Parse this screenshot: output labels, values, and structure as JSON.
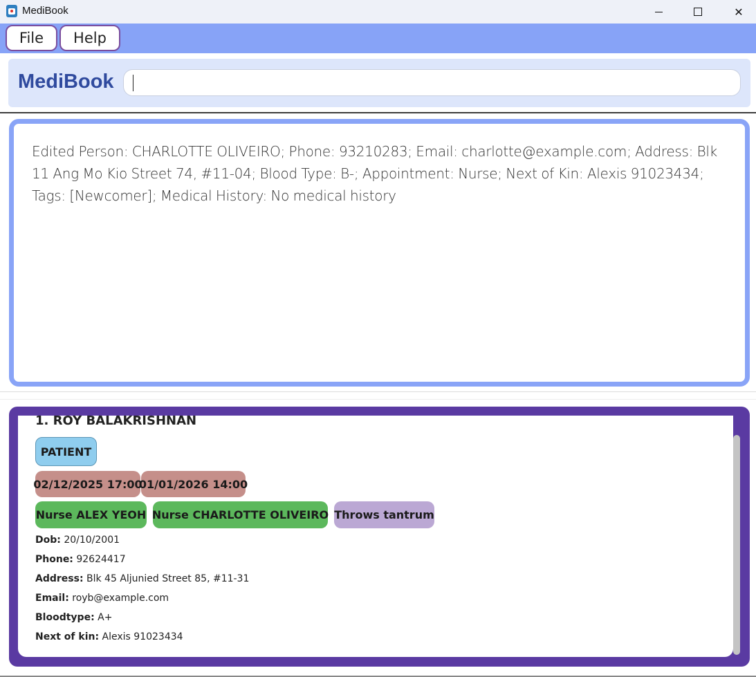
{
  "window": {
    "title": "MediBook",
    "min_icon": "minimize-icon",
    "max_icon": "maximize-icon",
    "close_glyph": "✕"
  },
  "menu": {
    "file": "File",
    "help": "Help"
  },
  "command": {
    "brand": "MediBook",
    "value": "",
    "placeholder": ""
  },
  "result": {
    "text": "Edited Person: CHARLOTTE OLIVEIRO; Phone: 93210283; Email: charlotte@example.com; Address: Blk 11 Ang Mo Kio Street 74, #11-04; Blood Type: B-; Appointment: Nurse; Next of Kin: Alexis 91023434; Tags: [Newcomer]; Medical History: No medical history"
  },
  "persons": [
    {
      "index_name": "1.  ROY BALAKRISHNAN",
      "role": "PATIENT",
      "appointments": [
        "02/12/2025 17:00",
        "01/01/2026 14:00"
      ],
      "nurses": [
        "Nurse ALEX YEOH",
        "Nurse CHARLOTTE OLIVEIRO"
      ],
      "tags": [
        "Throws tantrum"
      ],
      "fields": {
        "dob_label": "Dob:",
        "dob": "20/10/2001",
        "phone_label": "Phone:",
        "phone": "92624417",
        "address_label": "Address:",
        "address": "Blk 45 Aljunied Street 85, #11-31",
        "email_label": "Email:",
        "email": "royb@example.com",
        "blood_label": "Bloodtype:",
        "blood": "A+",
        "kin_label": "Next of kin:",
        "kin": "Alexis 91023434"
      }
    }
  ],
  "colors": {
    "menubar": "#87a3f7",
    "brand": "#2f4a9e",
    "result_border": "#89a4f7",
    "list_frame": "#5a3aa2",
    "role_chip": "#8fcdee",
    "appointment_chip": "#c58f8a",
    "nurse_chip": "#5cb85c",
    "tag_chip": "#bba8d4"
  }
}
